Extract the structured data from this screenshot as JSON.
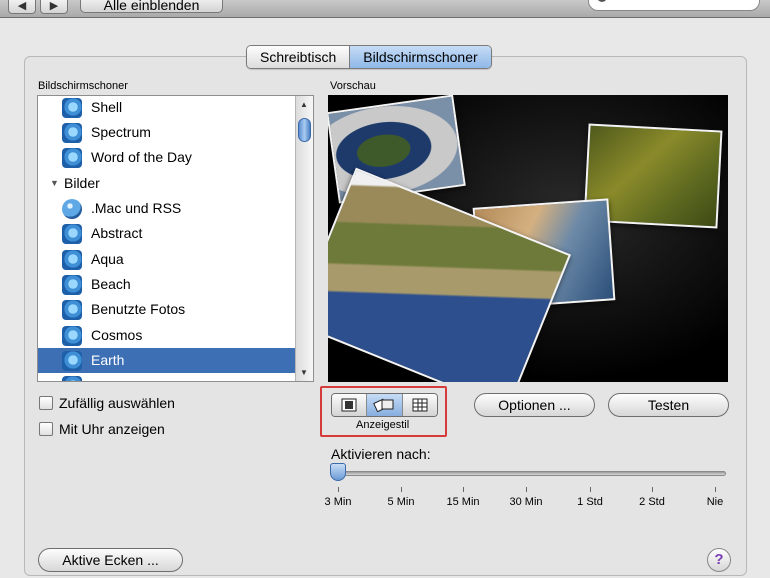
{
  "toolbar": {
    "back_label": "◀",
    "forward_label": "▶",
    "show_all_label": "Alle einblenden",
    "search_placeholder": ""
  },
  "tabs": [
    {
      "label": "Schreibtisch",
      "active": false
    },
    {
      "label": "Bildschirmschoner",
      "active": true
    }
  ],
  "list": {
    "title": "Bildschirmschoner",
    "items": [
      {
        "label": "Shell",
        "icon": "screensaver-icon"
      },
      {
        "label": "Spectrum",
        "icon": "screensaver-icon"
      },
      {
        "label": "Word of the Day",
        "icon": "screensaver-icon"
      },
      {
        "label": "Bilder",
        "icon": "disclosure-triangle-icon",
        "group": true
      },
      {
        "label": ".Mac und RSS",
        "icon": "globe-icon"
      },
      {
        "label": "Abstract",
        "icon": "screensaver-icon"
      },
      {
        "label": "Aqua",
        "icon": "screensaver-icon"
      },
      {
        "label": "Beach",
        "icon": "screensaver-icon"
      },
      {
        "label": "Benutzte Fotos",
        "icon": "screensaver-icon"
      },
      {
        "label": "Cosmos",
        "icon": "screensaver-icon"
      },
      {
        "label": "Earth",
        "icon": "screensaver-icon",
        "selected": true
      }
    ]
  },
  "checkboxes": {
    "random_label": "Zufällig auswählen",
    "clock_label": "Mit Uhr anzeigen"
  },
  "preview": {
    "title": "Vorschau"
  },
  "display_style": {
    "label": "Anzeigestil",
    "options": [
      "slideshow-icon",
      "collage-icon",
      "mosaic-icon"
    ],
    "selected": "collage-icon"
  },
  "buttons": {
    "options_label": "Optionen ...",
    "test_label": "Testen",
    "hot_corners_label": "Aktive Ecken ...",
    "help_label": "?"
  },
  "slider": {
    "label": "Aktivieren nach:",
    "ticks": [
      "3 Min",
      "5 Min",
      "15 Min",
      "30 Min",
      "1 Std",
      "2 Std",
      "Nie"
    ],
    "selected": "3 Min"
  }
}
